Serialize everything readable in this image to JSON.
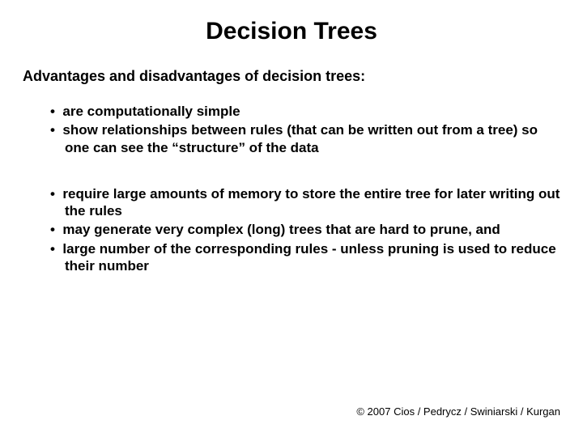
{
  "title": "Decision Trees",
  "subhead": "Advantages and disadvantages of decision trees:",
  "advantages": [
    "are computationally simple",
    "show relationships between rules (that can be written out from a tree) so one can see the “structure” of the data"
  ],
  "disadvantages": [
    "require large amounts of memory to store the entire tree for later writing out the rules",
    "may generate very complex (long) trees that are hard to prune, and",
    "large number of the corresponding rules - unless pruning is used to reduce their number"
  ],
  "footer": "© 2007 Cios / Pedrycz / Swiniarski / Kurgan"
}
